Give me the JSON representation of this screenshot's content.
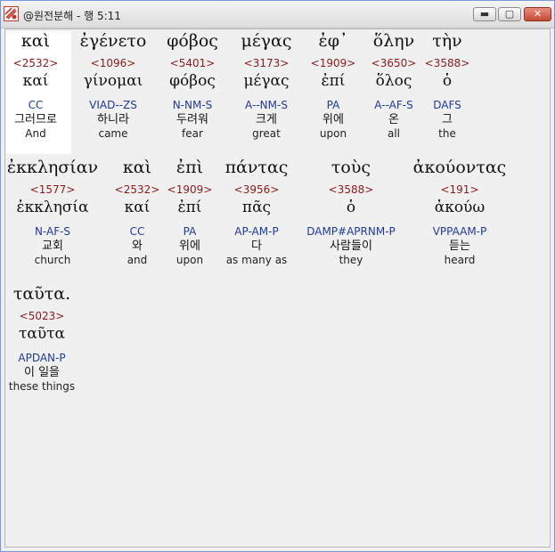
{
  "window": {
    "title": "@원전분해 - 행 5:11",
    "controls": {
      "minimize": "▬",
      "maximize": "▢",
      "close": "✕"
    }
  },
  "words": [
    {
      "greek": "καὶ",
      "strong": "<2532>",
      "lemma": "καί",
      "parse": "CC",
      "korean": "그러므로",
      "english": "And"
    },
    {
      "greek": "ἐγένετο",
      "strong": "<1096>",
      "lemma": "γίνομαι",
      "parse": "VIAD--ZS",
      "korean": "하니라",
      "english": "came"
    },
    {
      "greek": "φόβος",
      "strong": "<5401>",
      "lemma": "φόβος",
      "parse": "N-NM-S",
      "korean": "두려워",
      "english": "fear"
    },
    {
      "greek": "μέγας",
      "strong": "<3173>",
      "lemma": "μέγας",
      "parse": "A--NM-S",
      "korean": "크게",
      "english": "great"
    },
    {
      "greek": "ἐφ᾽",
      "strong": "<1909>",
      "lemma": "ἐπί",
      "parse": "PA",
      "korean": "위에",
      "english": "upon"
    },
    {
      "greek": "ὅλην",
      "strong": "<3650>",
      "lemma": "ὅλος",
      "parse": "A--AF-S",
      "korean": "온",
      "english": "all"
    },
    {
      "greek": "τὴν",
      "strong": "<3588>",
      "lemma": "ὁ",
      "parse": "DAFS",
      "korean": "그",
      "english": "the"
    },
    {
      "greek": "ἐκκλησίαν",
      "strong": "<1577>",
      "lemma": "ἐκκλησία",
      "parse": "N-AF-S",
      "korean": "교회",
      "english": "church"
    },
    {
      "greek": "καὶ",
      "strong": "<2532>",
      "lemma": "καί",
      "parse": "CC",
      "korean": "와",
      "english": "and"
    },
    {
      "greek": "ἐπὶ",
      "strong": "<1909>",
      "lemma": "ἐπί",
      "parse": "PA",
      "korean": "위에",
      "english": "upon"
    },
    {
      "greek": "πάντας",
      "strong": "<3956>",
      "lemma": "πᾶς",
      "parse": "AP-AM-P",
      "korean": "다",
      "english": "as many as"
    },
    {
      "greek": "τοὺς",
      "strong": "<3588>",
      "lemma": "ὁ",
      "parse": "DAMP#APRNM-P",
      "korean": "사람들이",
      "english": "they"
    },
    {
      "greek": "ἀκούοντας",
      "strong": "<191>",
      "lemma": "ἀκούω",
      "parse": "VPPAAM-P",
      "korean": "듣는",
      "english": "heard"
    },
    {
      "greek": "ταῦτα.",
      "strong": "<5023>",
      "lemma": "ταῦτα",
      "parse": "APDAN-P",
      "korean": "이 일을",
      "english": "these things"
    }
  ]
}
